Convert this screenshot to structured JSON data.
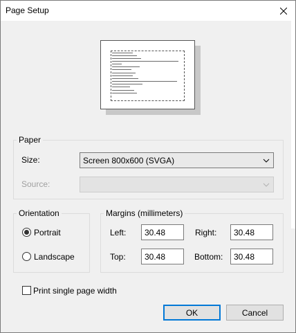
{
  "window": {
    "title": "Page Setup"
  },
  "paper": {
    "group_label": "Paper",
    "size_label": "Size:",
    "size_value": "Screen 800x600 (SVGA)",
    "source_label": "Source:",
    "source_value": ""
  },
  "orientation": {
    "group_label": "Orientation",
    "portrait_label": "Portrait",
    "landscape_label": "Landscape",
    "selected": "Portrait"
  },
  "margins": {
    "group_label": "Margins (millimeters)",
    "left_label": "Left:",
    "left_value": "30.48",
    "right_label": "Right:",
    "right_value": "30.48",
    "top_label": "Top:",
    "top_value": "30.48",
    "bottom_label": "Bottom:",
    "bottom_value": "30.48"
  },
  "options": {
    "single_page_width_label": "Print single page width",
    "single_page_width_checked": false
  },
  "buttons": {
    "ok_label": "OK",
    "cancel_label": "Cancel"
  },
  "icons": {
    "close": "close-icon",
    "dropdown": "chevron-down-icon"
  }
}
